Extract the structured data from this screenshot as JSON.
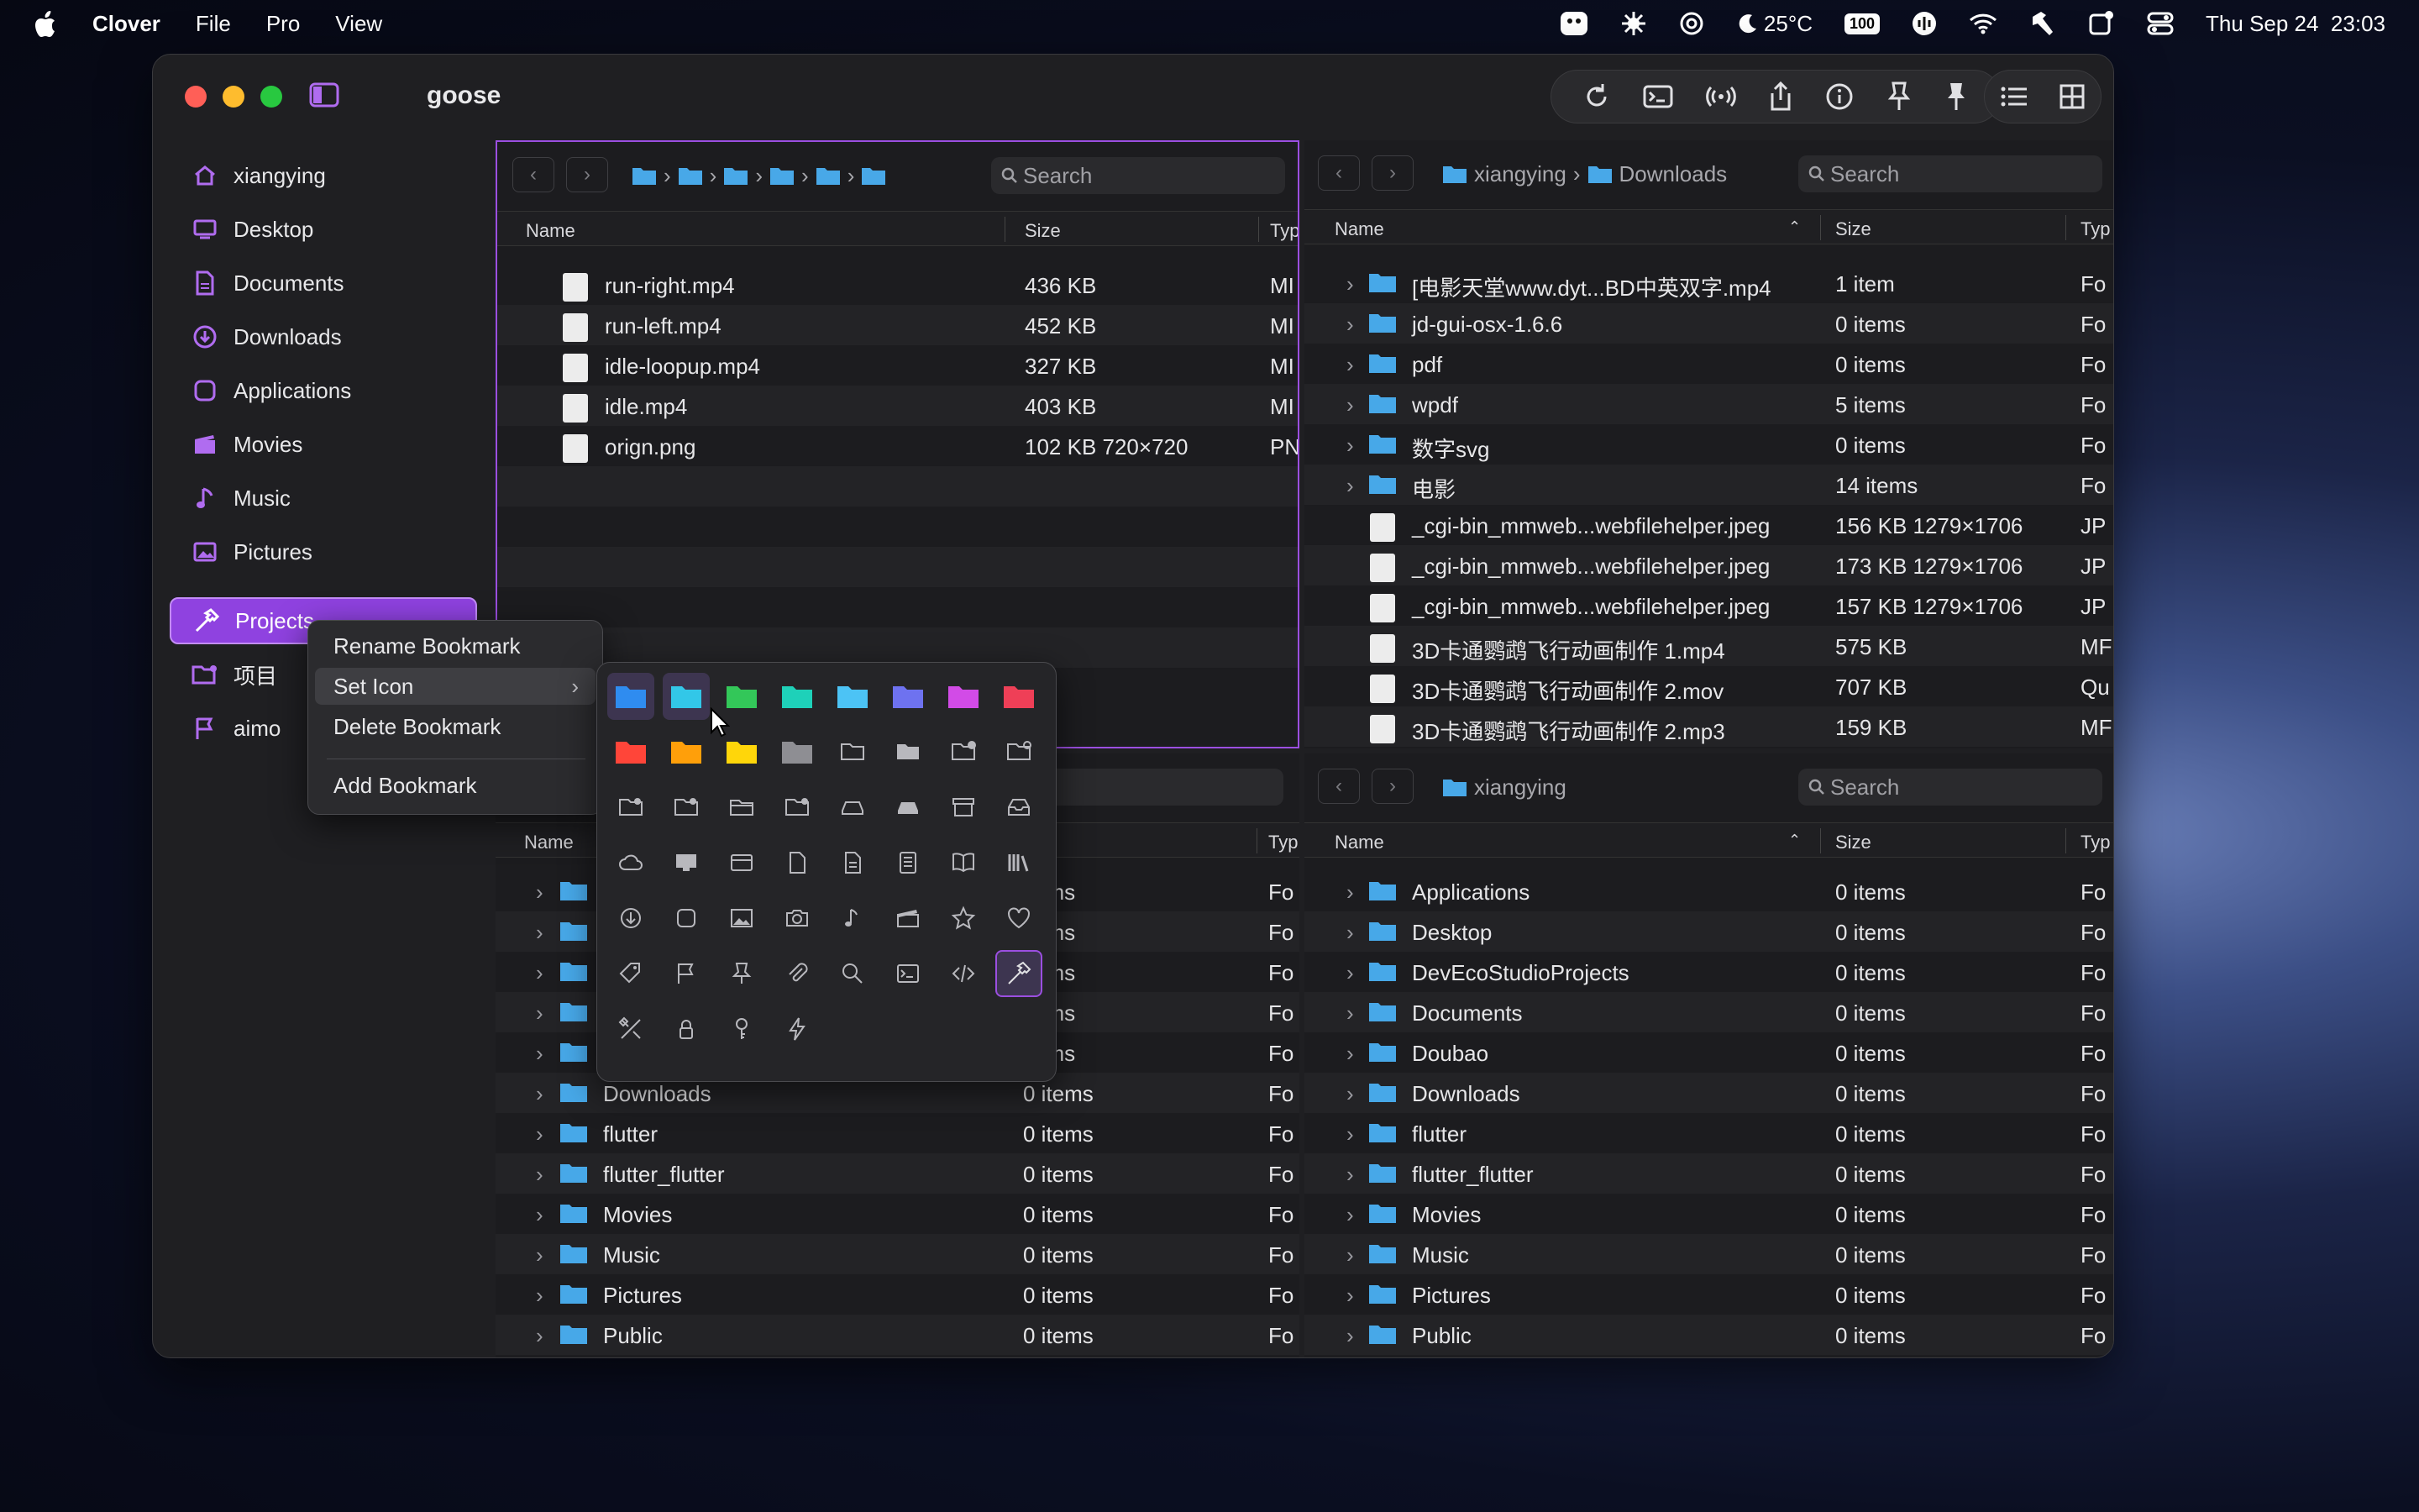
{
  "menubar": {
    "app": "Clover",
    "items": [
      "File",
      "Pro",
      "View"
    ],
    "weather": "25°C",
    "battery": "100",
    "datetime": "Thu Sep 24  23:03"
  },
  "window": {
    "title": "goose"
  },
  "sidebar": {
    "items": [
      {
        "label": "xiangying",
        "icon": "home-icon"
      },
      {
        "label": "Desktop",
        "icon": "desktop-icon"
      },
      {
        "label": "Documents",
        "icon": "document-icon"
      },
      {
        "label": "Downloads",
        "icon": "download-icon"
      },
      {
        "label": "Applications",
        "icon": "applications-icon"
      },
      {
        "label": "Movies",
        "icon": "film-icon"
      },
      {
        "label": "Music",
        "icon": "music-icon"
      },
      {
        "label": "Pictures",
        "icon": "picture-icon"
      },
      {
        "label": "Projects",
        "icon": "hammer-icon"
      },
      {
        "label": "项目",
        "icon": "folder-gear-icon"
      },
      {
        "label": "aimo",
        "icon": "flag-icon"
      }
    ]
  },
  "columns": {
    "name": "Name",
    "size": "Size",
    "type": "Typ"
  },
  "pane_tl": {
    "search_placeholder": "Search",
    "rows": [
      {
        "name": "run-right.mp4",
        "size": "436 KB",
        "type": "MI"
      },
      {
        "name": "run-left.mp4",
        "size": "452 KB",
        "type": "MI"
      },
      {
        "name": "idle-loopup.mp4",
        "size": "327 KB",
        "type": "MI"
      },
      {
        "name": "idle.mp4",
        "size": "403 KB",
        "type": "MI"
      },
      {
        "name": "orign.png",
        "size": "102 KB  720×720",
        "type": "PN"
      }
    ]
  },
  "pane_tr": {
    "crumb_user": "xiangying",
    "crumb_folder": "Downloads",
    "search_placeholder": "Search",
    "rows": [
      {
        "name": "[电影天堂www.dyt...BD中英双字.mp4",
        "size": "1 item",
        "type": "Fo",
        "folder": true
      },
      {
        "name": "jd-gui-osx-1.6.6",
        "size": "0 items",
        "type": "Fo",
        "folder": true
      },
      {
        "name": "pdf",
        "size": "0 items",
        "type": "Fo",
        "folder": true
      },
      {
        "name": "wpdf",
        "size": "5 items",
        "type": "Fo",
        "folder": true
      },
      {
        "name": "数字svg",
        "size": "0 items",
        "type": "Fo",
        "folder": true
      },
      {
        "name": "电影",
        "size": "14 items",
        "type": "Fo",
        "folder": true
      },
      {
        "name": "_cgi-bin_mmweb...webfilehelper.jpeg",
        "size": "156 KB  1279×1706",
        "type": "JP",
        "folder": false
      },
      {
        "name": "_cgi-bin_mmweb...webfilehelper.jpeg",
        "size": "173 KB  1279×1706",
        "type": "JP",
        "folder": false
      },
      {
        "name": "_cgi-bin_mmweb...webfilehelper.jpeg",
        "size": "157 KB  1279×1706",
        "type": "JP",
        "folder": false
      },
      {
        "name": "3D卡通鹦鹉飞行动画制作 1.mp4",
        "size": "575 KB",
        "type": "MF",
        "folder": false
      },
      {
        "name": "3D卡通鹦鹉飞行动画制作 2.mov",
        "size": "707 KB",
        "type": "Qu",
        "folder": false
      },
      {
        "name": "3D卡通鹦鹉飞行动画制作 2.mp3",
        "size": "159 KB",
        "type": "MF",
        "folder": false
      }
    ]
  },
  "pane_bl": {
    "search_placeholder": "rch",
    "rows": [
      {
        "name": "",
        "size": "items",
        "type": "Fo"
      },
      {
        "name": "",
        "size": "items",
        "type": "Fo"
      },
      {
        "name": "",
        "size": "items",
        "type": "Fo"
      },
      {
        "name": "",
        "size": "items",
        "type": "Fo"
      },
      {
        "name": "",
        "size": "items",
        "type": "Fo"
      },
      {
        "name": "Downloads",
        "size": "0 items",
        "type": "Fo"
      },
      {
        "name": "flutter",
        "size": "0 items",
        "type": "Fo"
      },
      {
        "name": "flutter_flutter",
        "size": "0 items",
        "type": "Fo"
      },
      {
        "name": "Movies",
        "size": "0 items",
        "type": "Fo"
      },
      {
        "name": "Music",
        "size": "0 items",
        "type": "Fo"
      },
      {
        "name": "Pictures",
        "size": "0 items",
        "type": "Fo"
      },
      {
        "name": "Public",
        "size": "0 items",
        "type": "Fo"
      }
    ]
  },
  "pane_br": {
    "crumb_user": "xiangying",
    "search_placeholder": "Search",
    "rows": [
      {
        "name": "Applications",
        "size": "0 items",
        "type": "Fo"
      },
      {
        "name": "Desktop",
        "size": "0 items",
        "type": "Fo"
      },
      {
        "name": "DevEcoStudioProjects",
        "size": "0 items",
        "type": "Fo"
      },
      {
        "name": "Documents",
        "size": "0 items",
        "type": "Fo"
      },
      {
        "name": "Doubao",
        "size": "0 items",
        "type": "Fo"
      },
      {
        "name": "Downloads",
        "size": "0 items",
        "type": "Fo"
      },
      {
        "name": "flutter",
        "size": "0 items",
        "type": "Fo"
      },
      {
        "name": "flutter_flutter",
        "size": "0 items",
        "type": "Fo"
      },
      {
        "name": "Movies",
        "size": "0 items",
        "type": "Fo"
      },
      {
        "name": "Music",
        "size": "0 items",
        "type": "Fo"
      },
      {
        "name": "Pictures",
        "size": "0 items",
        "type": "Fo"
      },
      {
        "name": "Public",
        "size": "0 items",
        "type": "Fo"
      }
    ]
  },
  "context_menu": {
    "rename": "Rename Bookmark",
    "set_icon": "Set Icon",
    "delete": "Delete Bookmark",
    "add": "Add Bookmark"
  },
  "icon_picker": {
    "colors": [
      "#2f8cf0",
      "#33c7e8",
      "#34c759",
      "#1fd1b8",
      "#4cc3f5",
      "#6e72f0",
      "#d24be6",
      "#ee4057",
      "#ff453a",
      "#ff9f0a",
      "#ffd60a",
      "#8e8e93"
    ],
    "icons": [
      "folder-icon",
      "folder-filled-icon",
      "folder-add-icon",
      "folder-gear-icon",
      "folder-person-icon",
      "folder-question-icon",
      "folder-open-icon",
      "folder-minus-icon",
      "drive-icon",
      "drive-filled-icon",
      "archive-icon",
      "tray-icon",
      "cloud-icon",
      "desktop-icon",
      "card-icon",
      "document-icon",
      "document-text-icon",
      "document-list-icon",
      "book-icon",
      "library-icon",
      "download-icon",
      "app-square-icon",
      "photo-icon",
      "camera-icon",
      "music-note-icon",
      "film-icon",
      "star-icon",
      "heart-icon",
      "tag-icon",
      "flag-icon",
      "pin-icon",
      "paperclip-icon",
      "search-icon",
      "terminal-icon",
      "code-icon",
      "hammer-icon",
      "tools-icon",
      "lock-icon",
      "key-icon",
      "bolt-icon"
    ]
  }
}
